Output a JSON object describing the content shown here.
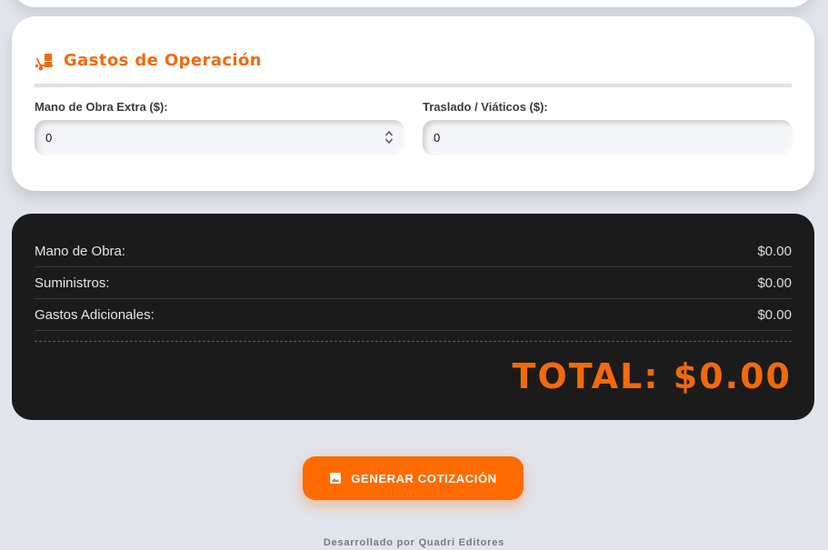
{
  "operations": {
    "title": "Gastos de Operación",
    "icon": "truck-loading-icon",
    "accent_color": "#f26a0c",
    "fields": [
      {
        "label": "Mano de Obra Extra ($):",
        "value": "0"
      },
      {
        "label": "Traslado / Viáticos ($):",
        "value": "0"
      }
    ]
  },
  "summary": {
    "rows": [
      {
        "label": "Mano de Obra:",
        "value": "$0.00"
      },
      {
        "label": "Suministros:",
        "value": "$0.00"
      },
      {
        "label": "Gastos Adicionales:",
        "value": "$0.00"
      }
    ],
    "total": "TOTAL: $0.00"
  },
  "actions": {
    "generate_label": "GENERAR COTIZACIÓN",
    "generate_icon": "image-icon",
    "button_color": "#ff6a00"
  },
  "footer": {
    "text": "Desarrollado por Quadri Editores"
  }
}
